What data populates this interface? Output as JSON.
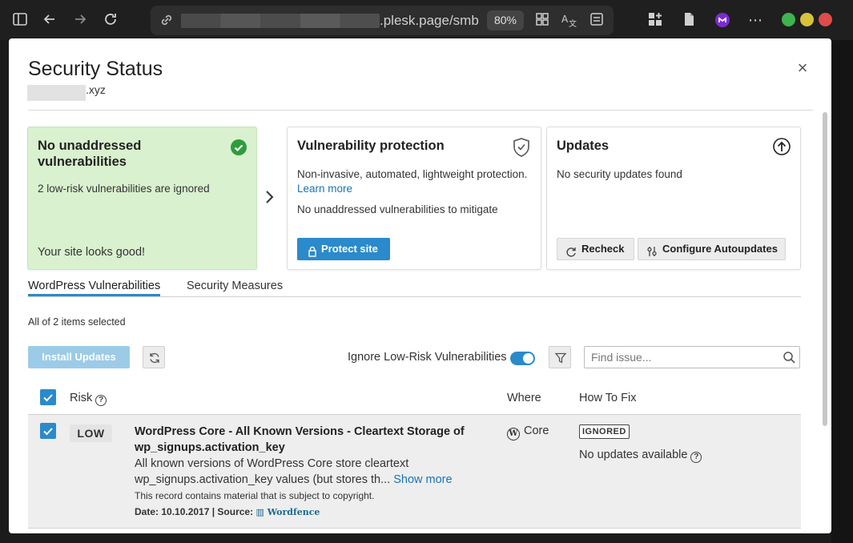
{
  "browser": {
    "url_suffix": ".plesk.page/smb",
    "zoom": "80%"
  },
  "modal": {
    "title": "Security Status",
    "domain_suffix": ".xyz",
    "close_label": "×"
  },
  "cards": {
    "status": {
      "title": "No unaddressed vulnerabilities",
      "note": "2 low-risk vulnerabilities are ignored",
      "footer": "Your site looks good!"
    },
    "protection": {
      "title": "Vulnerability protection",
      "description": "Non-invasive, automated, lightweight protection.",
      "learn_more": "Learn more",
      "status": "No unaddressed vulnerabilities to mitigate",
      "button": "Protect site"
    },
    "updates": {
      "title": "Updates",
      "status": "No security updates found",
      "recheck": "Recheck",
      "autoupdates": "Configure Autoupdates"
    }
  },
  "tabs": [
    {
      "label": "WordPress Vulnerabilities",
      "active": true
    },
    {
      "label": "Security Measures",
      "active": false
    }
  ],
  "selection_text": "All of 2 items selected",
  "toolbar": {
    "install_updates": "Install Updates",
    "ignore_low_risk": "Ignore Low-Risk Vulnerabilities",
    "ignore_low_risk_enabled": true,
    "search_placeholder": "Find issue..."
  },
  "table": {
    "columns": [
      "Risk",
      "Where",
      "How To Fix"
    ],
    "rows": [
      {
        "selected": true,
        "risk": "LOW",
        "title": "WordPress Core - All Known Versions - Cleartext Storage of wp_signups.activation_key",
        "description": "All known versions of WordPress Core store cleartext wp_signups.activation_key values (but stores th...",
        "show_more": "Show more",
        "copyright": "This record contains material that is subject to copyright.",
        "date_source": "Date: 10.10.2017 | Source:",
        "source": "Wordfence",
        "where": "Core",
        "status_badge": "IGNORED",
        "fix": "No updates available"
      }
    ]
  },
  "colors": {
    "accent": "#2a8acb",
    "success_bg": "#d9f1cf",
    "success_icon": "#2e9c3d",
    "link": "#1a73b5"
  }
}
